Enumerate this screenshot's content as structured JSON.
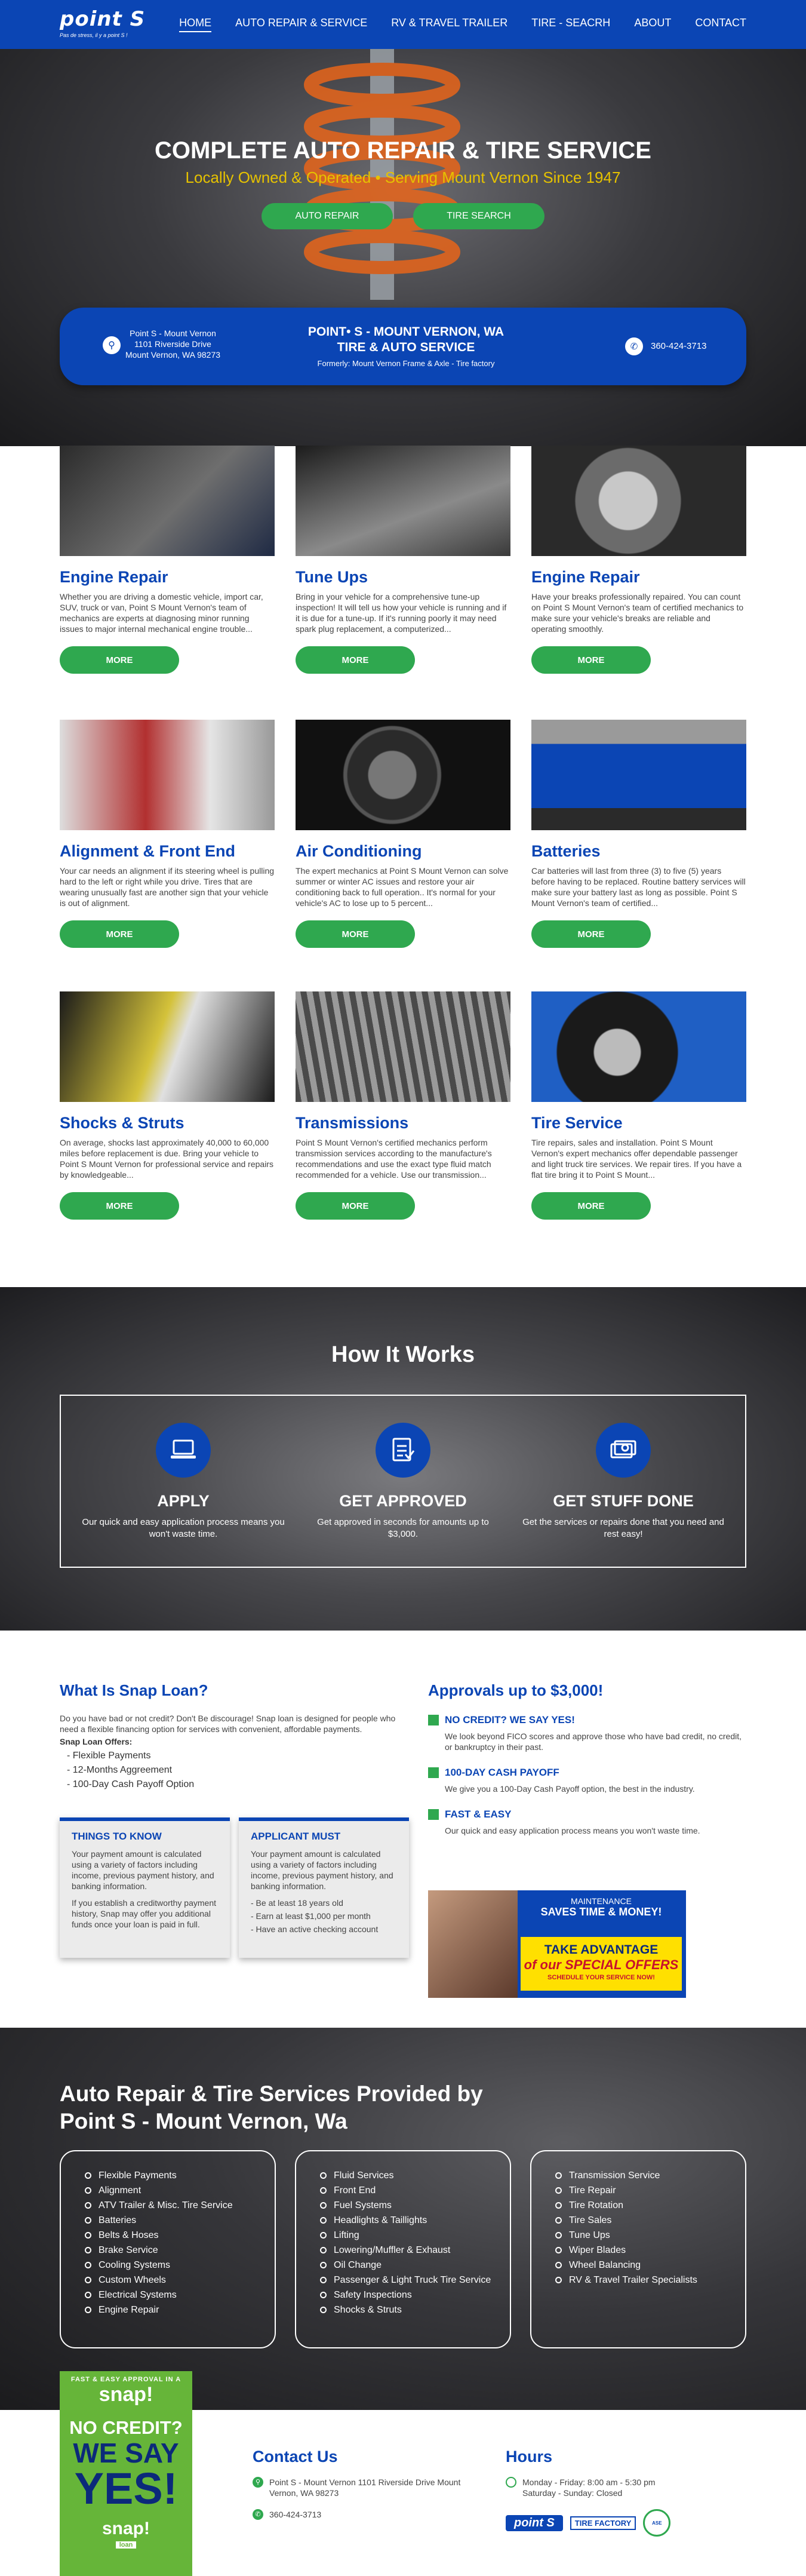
{
  "header": {
    "logo": "point S",
    "tagline": "Pas de stress, il y a point S !",
    "nav": [
      "HOME",
      "AUTO REPAIR & SERVICE",
      "RV & TRAVEL TRAILER",
      "TIRE - SEACRH",
      "ABOUT",
      "CONTACT"
    ]
  },
  "hero": {
    "title": "COMPLETE AUTO REPAIR & TIRE SERVICE",
    "subtitle": "Locally Owned & Operated • Serving Mount Vernon Since 1947",
    "btn_repair": "AUTO REPAIR",
    "btn_tire": "TIRE SEARCH"
  },
  "infobar": {
    "address_line1": "Point S - Mount Vernon",
    "address_line2": "1101 Riverside Drive",
    "address_line3": "Mount Vernon, WA 98273",
    "title_line1": "POINT• S - MOUNT VERNON, WA",
    "title_line2": "TIRE & AUTO SERVICE",
    "formerly": "Formerly: Mount Vernon Frame & Axle - Tire factory",
    "phone": "360-424-3713"
  },
  "services": [
    {
      "title": "Engine Repair",
      "desc": "Whether you are driving a domestic vehicle, import car, SUV, truck or van, Point S Mount Vernon's team of mechanics are experts at diagnosing minor running issues to major internal mechanical engine trouble...",
      "btn": "MORE"
    },
    {
      "title": "Tune Ups",
      "desc": "Bring in your vehicle for a comprehensive tune-up inspection! It will tell us how your vehicle is running and if it is due for a tune-up. If it's running poorly it may need spark plug replacement, a computerized...",
      "btn": "MORE"
    },
    {
      "title": "Engine Repair",
      "desc": "Have your breaks professionally repaired. You can count on Point S Mount Vernon's team of certified mechanics to make sure your vehicle's breaks are reliable and operating smoothly.",
      "btn": "MORE"
    },
    {
      "title": "Alignment & Front End",
      "desc": "Your car needs an alignment if its steering wheel is pulling hard to the left or right while you drive. Tires that are wearing unusually fast are another sign that your vehicle is out of alignment.",
      "btn": "MORE"
    },
    {
      "title": "Air Conditioning",
      "desc": "The expert mechanics at Point S Mount Vernon can solve summer or winter AC issues and restore your air conditioning back to full operation.. It's normal for your vehicle's AC to lose up to 5 percent...",
      "btn": "MORE"
    },
    {
      "title": "Batteries",
      "desc": "Car batteries will last from three (3) to five (5) years before having to be replaced. Routine battery services will make sure your battery last as long as possible.  Point S Mount Vernon's team of certified...",
      "btn": "MORE"
    },
    {
      "title": "Shocks & Struts",
      "desc": "On average, shocks last approximately 40,000 to 60,000 miles before replacement is due. Bring your vehicle to Point S Mount Vernon for professional service and repairs by knowledgeable...",
      "btn": "MORE"
    },
    {
      "title": "Transmissions",
      "desc": "Point S Mount Vernon's certified mechanics perform transmission services according to the manufacture's recommendations and use the exact type fluid match recommended for a vehicle.  Use our transmission...",
      "btn": "MORE"
    },
    {
      "title": "Tire Service",
      "desc": "Tire repairs, sales and installation. Point S Mount Vernon's expert mechanics offer dependable passenger and light truck tire services. We repair tires. If you have a flat tire bring it to Point S Mount...",
      "btn": "MORE"
    }
  ],
  "how": {
    "title": "How It Works",
    "steps": [
      {
        "title": "APPLY",
        "desc": "Our quick and easy application process means you won't waste time."
      },
      {
        "title": "GET APPROVED",
        "desc": "Get approved in seconds for amounts up to $3,000."
      },
      {
        "title": "GET STUFF DONE",
        "desc": "Get the services or repairs done that you need and rest easy!"
      }
    ]
  },
  "snap": {
    "title": "What Is Snap Loan?",
    "intro": "Do you have bad or not credit? Don't Be discourage! Snap loan is designed for people who need a flexible financing option for services with convenient, affordable payments.",
    "offers_title": "Snap Loan Offers:",
    "offers": [
      "- Flexible Payments",
      "- 12-Months Aggreement",
      "- 100-Day Cash Payoff Option"
    ],
    "box1_title": "THINGS TO KNOW",
    "box1_p1": "Your payment amount is calculated using a variety of factors including income, previous payment history, and banking information.",
    "box1_p2": "If you establish a creditworthy payment history, Snap may offer you additional funds once your loan is paid in full.",
    "box2_title": "APPLICANT MUST",
    "box2_p1": "Your payment amount is calculated using a variety of factors including income, previous payment history, and banking information.",
    "box2_items": [
      "- Be at least 18 years old",
      "- Earn at least $1,000 per month",
      "- Have an active checking account"
    ]
  },
  "approvals": {
    "title": "Approvals up to $3,000!",
    "items": [
      {
        "head": "NO CREDIT? WE SAY YES!",
        "desc": "We look beyond FICO scores and approve those who have bad credit, no credit, or bankruptcy in their past."
      },
      {
        "head": "100-DAY CASH PAYOFF",
        "desc": "We give you a 100-Day Cash Payoff option, the best in the industry."
      },
      {
        "head": "FAST & EASY",
        "desc": "Our quick and easy application process means you won't waste time."
      }
    ],
    "promo_line1": "MAINTENANCE",
    "promo_line2": "SAVES TIME & MONEY!",
    "promo_y1": "TAKE ADVANTAGE",
    "promo_y2": "of our SPECIAL OFFERS",
    "promo_y3": "SCHEDULE YOUR SERVICE NOW!"
  },
  "provided": {
    "title": "Auto Repair & Tire Services Provided by Point S - Mount Vernon, Wa",
    "col1": [
      "Flexible Payments",
      "Alignment",
      "ATV Trailer & Misc. Tire Service",
      "Batteries",
      "Belts & Hoses",
      "Brake Service",
      "Cooling Systems",
      "Custom Wheels",
      "Electrical Systems",
      "Engine Repair"
    ],
    "col2": [
      "Fluid Services",
      "Front End",
      "Fuel Systems",
      "Headlights & Taillights",
      "Lifting",
      "Lowering/Muffler & Exhaust",
      "Oil Change",
      "Passenger & Light Truck Tire Service",
      "Safety Inspections",
      "Shocks & Struts"
    ],
    "col3": [
      "Transmission Service",
      "Tire Repair",
      "Tire Rotation",
      "Tire Sales",
      "Tune Ups",
      "Wiper Blades",
      "Wheel Balancing",
      "RV & Travel Trailer Specialists"
    ]
  },
  "ad": {
    "top": "FAST & EASY APPROVAL IN A",
    "snap": "snap!",
    "no_credit": "NO CREDIT?",
    "we_say": "WE SAY",
    "yes": "YES!",
    "snap2": "snap!",
    "loan": "loan"
  },
  "contact": {
    "title": "Contact Us",
    "address": "Point S - Mount Vernon 1101 Riverside Drive Mount Vernon, WA 98273",
    "phone": "360-424-3713"
  },
  "hours": {
    "title": "Hours",
    "line1": "Monday - Friday: 8:00 am - 5:30 pm",
    "line2": "Saturday - Sunday: Closed",
    "badge1": "point S",
    "badge2": "TIRE FACTORY",
    "badge3": "ASE"
  },
  "colors": {
    "brand_blue": "#0b45b4",
    "green": "#2fa84f",
    "yellow": "#e6c200"
  }
}
